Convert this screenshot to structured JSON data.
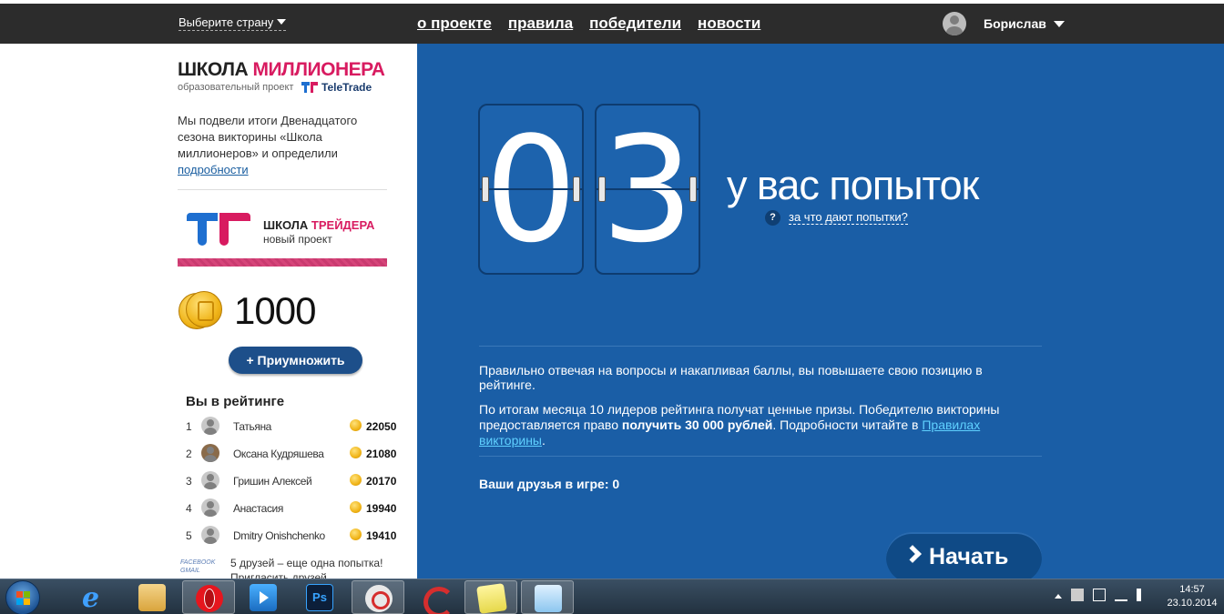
{
  "topbar": {
    "country_selector": "Выберите страну",
    "nav": [
      "о проекте",
      "правила",
      "победители",
      "новости"
    ],
    "username": "Борислав"
  },
  "sidebar": {
    "logo_black": "ШКОЛА ",
    "logo_pink": "МИЛЛИОНЕРА",
    "logo_sub": "образовательный проект",
    "teletrade": "TeleTrade",
    "intro_text": "Мы подвели итоги Двенадцатого сезона викторины «Школа миллионеров» и определили",
    "intro_link": "подробности",
    "trader_black": "ШКОЛА ",
    "trader_pink": "ТРЕЙДЕРА",
    "trader_sub": "новый проект",
    "balance": "1000",
    "multiply_button": "+ Приумножить",
    "rating_title": "Вы в рейтинге",
    "rating": [
      {
        "rank": "1",
        "name": "Татьяна",
        "score": "22050"
      },
      {
        "rank": "2",
        "name": "Оксана Кудряшева",
        "score": "21080"
      },
      {
        "rank": "3",
        "name": "Гришин Алексей",
        "score": "20170"
      },
      {
        "rank": "4",
        "name": "Анастасия",
        "score": "19940"
      },
      {
        "rank": "5",
        "name": "Dmitry Onishchenko",
        "score": "19410"
      }
    ],
    "social_badge": "FACEBOOK GMAIL",
    "friends_note": "5 друзей – еще одна попытка!",
    "friends_note2": "Пригласить друзей"
  },
  "main": {
    "digit1": "0",
    "digit2": "3",
    "attempts_label": "у вас попыток",
    "why_link": "за что дают попытки?",
    "help_icon": "?",
    "paragraph1": "Правильно отвечая на вопросы и накапливая баллы, вы повышаете свою позицию в рейтинге.",
    "paragraph2_a": "По итогам месяца 10 лидеров рейтинга получат ценные призы. Победителю викторины предоставляется право ",
    "paragraph2_b": "получить 30 000 рублей",
    "paragraph2_c": ". Подробности читайте в ",
    "paragraph2_link": "Правилах викторины",
    "paragraph2_d": ".",
    "friends_in_game": "Ваши друзья в игре: 0",
    "start_button": "Начать"
  },
  "taskbar": {
    "time": "14:57",
    "date": "23.10.2014",
    "ps_label": "Ps",
    "icons": [
      "windows-start-icon",
      "internet-explorer-icon",
      "file-explorer-icon",
      "opera-icon",
      "media-player-icon",
      "photoshop-icon",
      "snipping-tool-icon",
      "ccleaner-icon",
      "sticky-notes-icon",
      "notepad-icon"
    ]
  }
}
